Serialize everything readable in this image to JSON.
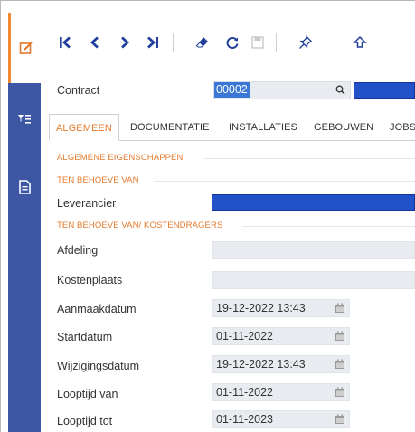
{
  "toolbar": {
    "icons": [
      "first-icon",
      "prev-icon",
      "next-icon",
      "last-icon",
      "eraser-icon",
      "refresh-icon",
      "save-icon",
      "pin-icon",
      "upload-icon"
    ]
  },
  "form": {
    "contract_label": "Contract",
    "contract_value": "00002",
    "tabs": [
      "ALGEMEEN",
      "DOCUMENTATIE",
      "INSTALLATIES",
      "GEBOUWEN",
      "JOBS"
    ],
    "section_general": "ALGEMENE EIGENSCHAPPEN",
    "section_behalf": "TEN BEHOEVE VAN",
    "leverancier_label": "Leverancier",
    "section_cost": "TEN BEHOEVE VAN/ KOSTENDRAGERS",
    "afdeling_label": "Afdeling",
    "kostenplaats_label": "Kostenplaats",
    "aanmaakdatum_label": "Aanmaakdatum",
    "aanmaakdatum_value": "19-12-2022 13:43",
    "startdatum_label": "Startdatum",
    "startdatum_value": "01-11-2022",
    "wijzigingsdatum_label": "Wijzigingsdatum",
    "wijzigingsdatum_value": "19-12-2022 13:43",
    "looptijd_van_label": "Looptijd van",
    "looptijd_van_value": "01-11-2022",
    "looptijd_tot_label": "Looptijd tot",
    "looptijd_tot_value": "01-11-2023"
  },
  "colors": {
    "accent": "#e67a2c",
    "rail": "#3d57a5",
    "toolbar_icon": "#1f3f9b",
    "redacted": "#2352c8"
  }
}
